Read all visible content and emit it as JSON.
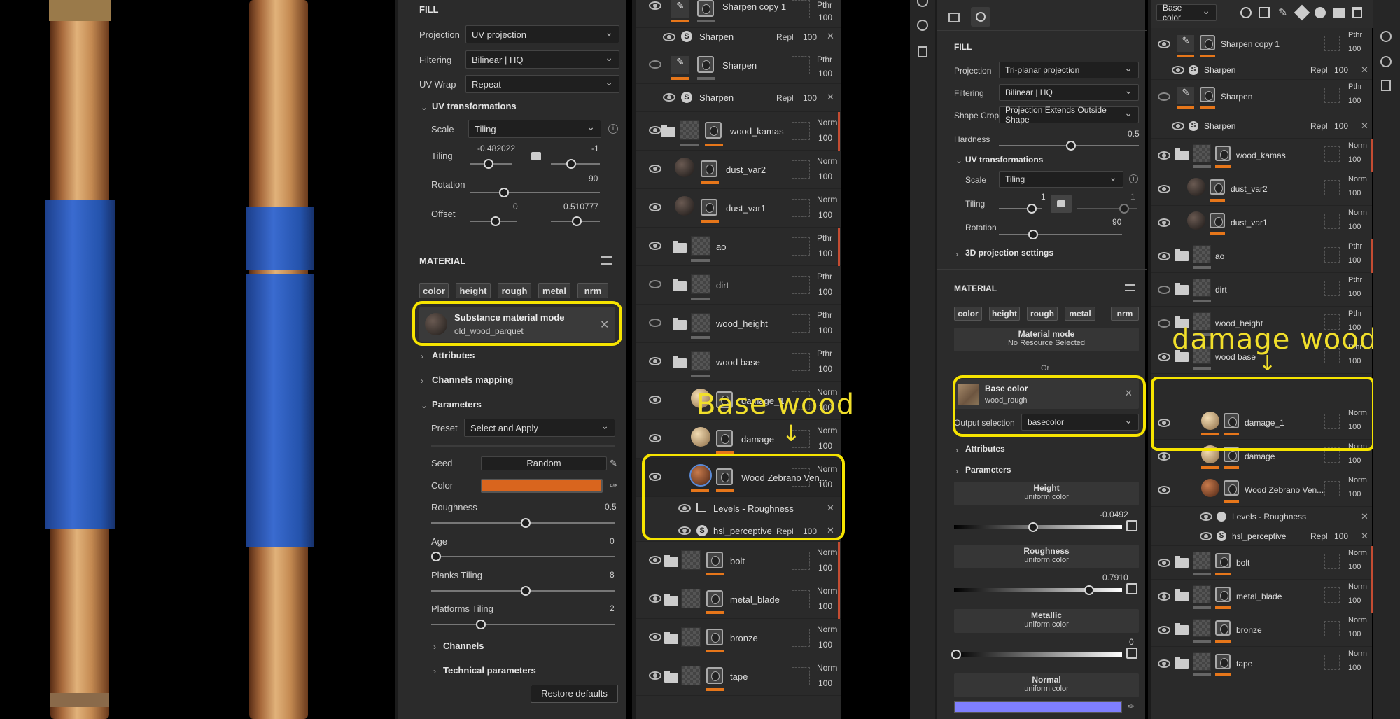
{
  "left_fill": {
    "section": "FILL",
    "projection_label": "Projection",
    "projection_value": "UV projection",
    "filtering_label": "Filtering",
    "filtering_value": "Bilinear | HQ",
    "uvwrap_label": "UV Wrap",
    "uvwrap_value": "Repeat",
    "uvtrans": "UV transformations",
    "scale_label": "Scale",
    "scale_value": "Tiling",
    "tiling_label": "Tiling",
    "tiling_a": "-0.482022",
    "tiling_b": "-1",
    "rotation_label": "Rotation",
    "rotation_value": "90",
    "offset_label": "Offset",
    "offset_a": "0",
    "offset_b": "0.510777"
  },
  "left_material": {
    "section": "MATERIAL",
    "chips": [
      "color",
      "height",
      "rough",
      "metal",
      "nrm"
    ],
    "mode_title": "Substance material mode",
    "mode_value": "old_wood_parquet",
    "attributes": "Attributes",
    "channels_mapping": "Channels mapping",
    "parameters": "Parameters",
    "preset_label": "Preset",
    "preset_value": "Select and Apply",
    "seed_label": "Seed",
    "seed_value": "Random",
    "color_label": "Color",
    "color_hex": "#d9651e",
    "roughness_label": "Roughness",
    "roughness_value": "0.5",
    "age_label": "Age",
    "age_value": "0",
    "planks_label": "Planks Tiling",
    "planks_value": "8",
    "platforms_label": "Platforms Tiling",
    "platforms_value": "2",
    "channels": "Channels",
    "technical": "Technical parameters",
    "restore": "Restore defaults"
  },
  "left_layers": [
    {
      "name": "Sharpen copy 1",
      "blend": "Pthr",
      "op": "100"
    },
    {
      "name": "Sharpen",
      "blend": "Repl",
      "op": "100"
    },
    {
      "name": "Sharpen",
      "blend": "Pthr",
      "op": "100"
    },
    {
      "name": "Sharpen",
      "blend": "Repl",
      "op": "100"
    },
    {
      "name": "wood_kamas",
      "blend": "Norm",
      "op": "100"
    },
    {
      "name": "dust_var2",
      "blend": "Norm",
      "op": "100"
    },
    {
      "name": "dust_var1",
      "blend": "Norm",
      "op": "100"
    },
    {
      "name": "ao",
      "blend": "Pthr",
      "op": "100"
    },
    {
      "name": "dirt",
      "blend": "Pthr",
      "op": "100"
    },
    {
      "name": "wood_height",
      "blend": "Pthr",
      "op": "100"
    },
    {
      "name": "wood base",
      "blend": "Pthr",
      "op": "100"
    },
    {
      "name": "damage_1",
      "blend": "Norm",
      "op": "100"
    },
    {
      "name": "damage",
      "blend": "Norm",
      "op": "100"
    },
    {
      "name": "Wood Zebrano Ven...",
      "blend": "Norm",
      "op": "100"
    },
    {
      "name": "Levels - Roughness",
      "blend": "",
      "op": ""
    },
    {
      "name": "hsl_perceptive",
      "blend": "Repl",
      "op": "100"
    },
    {
      "name": "bolt",
      "blend": "Norm",
      "op": "100"
    },
    {
      "name": "metal_blade",
      "blend": "Norm",
      "op": "100"
    },
    {
      "name": "bronze",
      "blend": "Norm",
      "op": "100"
    },
    {
      "name": "tape",
      "blend": "Norm",
      "op": "100"
    }
  ],
  "right_fill": {
    "section": "FILL",
    "projection_label": "Projection",
    "projection_value": "Tri-planar projection",
    "filtering_label": "Filtering",
    "filtering_value": "Bilinear | HQ",
    "shapecrop_label": "Shape Crop",
    "shapecrop_value": "Projection Extends Outside Shape",
    "hardness_label": "Hardness",
    "hardness_value": "0.5",
    "uvtrans": "UV transformations",
    "scale_label": "Scale",
    "scale_value": "Tiling",
    "tiling_label": "Tiling",
    "tiling_a": "1",
    "tiling_b": "1",
    "rotation_label": "Rotation",
    "rotation_value": "90",
    "proj3d": "3D projection settings"
  },
  "right_material": {
    "section": "MATERIAL",
    "chips": [
      "color",
      "height",
      "rough",
      "metal",
      "nrm"
    ],
    "mode_title": "Material mode",
    "mode_value": "No Resource Selected",
    "or": "Or",
    "base_title": "Base color",
    "base_value": "wood_rough",
    "output_label": "Output selection",
    "output_value": "basecolor",
    "attributes": "Attributes",
    "parameters": "Parameters",
    "height_title": "Height",
    "height_sub": "uniform color",
    "height_value": "-0.0492",
    "rough_title": "Roughness",
    "rough_sub": "uniform color",
    "rough_value": "0.7910",
    "metal_title": "Metallic",
    "metal_sub": "uniform color",
    "metal_value": "0",
    "normal_title": "Normal",
    "normal_sub": "uniform color",
    "normal_color": "#7f7fff"
  },
  "right_header": {
    "channel": "Base color"
  },
  "right_layers": [
    {
      "name": "Sharpen copy 1",
      "blend": "Pthr",
      "op": "100"
    },
    {
      "name": "Sharpen",
      "blend": "Repl",
      "op": "100"
    },
    {
      "name": "Sharpen",
      "blend": "Pthr",
      "op": "100"
    },
    {
      "name": "Sharpen",
      "blend": "Repl",
      "op": "100"
    },
    {
      "name": "wood_kamas",
      "blend": "Norm",
      "op": "100"
    },
    {
      "name": "dust_var2",
      "blend": "Norm",
      "op": "100"
    },
    {
      "name": "dust_var1",
      "blend": "Norm",
      "op": "100"
    },
    {
      "name": "ao",
      "blend": "Pthr",
      "op": "100"
    },
    {
      "name": "dirt",
      "blend": "Pthr",
      "op": "100"
    },
    {
      "name": "wood_height",
      "blend": "Pthr",
      "op": "100"
    },
    {
      "name": "wood base",
      "blend": "Pthr",
      "op": "100"
    },
    {
      "name": "damage_1",
      "blend": "Norm",
      "op": "100"
    },
    {
      "name": "damage",
      "blend": "Norm",
      "op": "100"
    },
    {
      "name": "Wood Zebrano Ven...",
      "blend": "Norm",
      "op": "100"
    },
    {
      "name": "Levels - Roughness",
      "blend": "",
      "op": ""
    },
    {
      "name": "hsl_perceptive",
      "blend": "Repl",
      "op": "100"
    },
    {
      "name": "bolt",
      "blend": "Norm",
      "op": "100"
    },
    {
      "name": "metal_blade",
      "blend": "Norm",
      "op": "100"
    },
    {
      "name": "bronze",
      "blend": "Norm",
      "op": "100"
    },
    {
      "name": "tape",
      "blend": "Norm",
      "op": "100"
    }
  ],
  "annotations": {
    "base_wood": "Base wood",
    "damage_wood": "damage wood",
    "arrow": "↓"
  },
  "colors": {
    "accent_orange": "#e6761a",
    "highlight_yellow": "#f6e400",
    "tape_blue": "#2a58b8"
  }
}
